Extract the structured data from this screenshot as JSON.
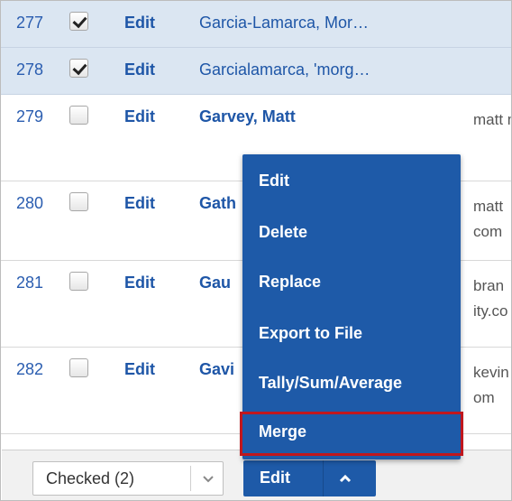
{
  "rows": [
    {
      "num": "277",
      "checked": true,
      "edit": "Edit",
      "name": "Garcia-Lamarca, Mor…",
      "email": ""
    },
    {
      "num": "278",
      "checked": true,
      "edit": "Edit",
      "name": "Garcialamarca, 'morg…",
      "email": ""
    },
    {
      "num": "279",
      "checked": false,
      "edit": "Edit",
      "name": "Garvey, Matt",
      "email": "matt m"
    },
    {
      "num": "280",
      "checked": false,
      "edit": "Edit",
      "name": "Gath",
      "email": "matt com"
    },
    {
      "num": "281",
      "checked": false,
      "edit": "Edit",
      "name": "Gau",
      "email": "bran ity.co"
    },
    {
      "num": "282",
      "checked": false,
      "edit": "Edit",
      "name": "Gavi",
      "email": "kevin om"
    }
  ],
  "menu": {
    "items": [
      "Edit",
      "Delete",
      "Replace",
      "Export to File",
      "Tally/Sum/Average",
      "Merge"
    ],
    "highlighted": "Merge",
    "highlight_color": "#c0171d"
  },
  "bottom": {
    "select_value": "Checked (2)",
    "edit_label": "Edit"
  },
  "colors": {
    "accent": "#1e5aa8",
    "link": "#1e56a7",
    "selected_row": "#dbe6f2"
  }
}
